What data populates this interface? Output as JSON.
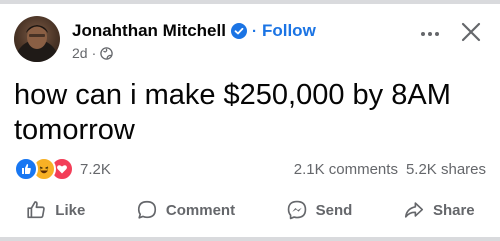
{
  "post": {
    "author": {
      "name": "Jonahthan Mitchell",
      "follow_label": "Follow",
      "separator": "·"
    },
    "meta": {
      "age": "2d",
      "separator": "·",
      "audience_icon": "globe-icon"
    },
    "text": "how can i make $250,000 by 8AM tomorrow",
    "reactions": {
      "icons": [
        "like",
        "haha",
        "love"
      ],
      "count": "7.2K"
    },
    "comments_count": "2.1K comments",
    "shares_count": "5.2K shares"
  },
  "actions": [
    {
      "id": "like",
      "label": "Like",
      "icon": "thumbs-up-icon"
    },
    {
      "id": "comment",
      "label": "Comment",
      "icon": "comment-bubble-icon"
    },
    {
      "id": "send",
      "label": "Send",
      "icon": "messenger-icon"
    },
    {
      "id": "share",
      "label": "Share",
      "icon": "share-arrow-icon"
    }
  ],
  "colors": {
    "accent": "#1b74e4",
    "secondary_text": "#65676b",
    "like": "#1877f2",
    "love": "#f33e58",
    "haha": "#f7b125"
  }
}
